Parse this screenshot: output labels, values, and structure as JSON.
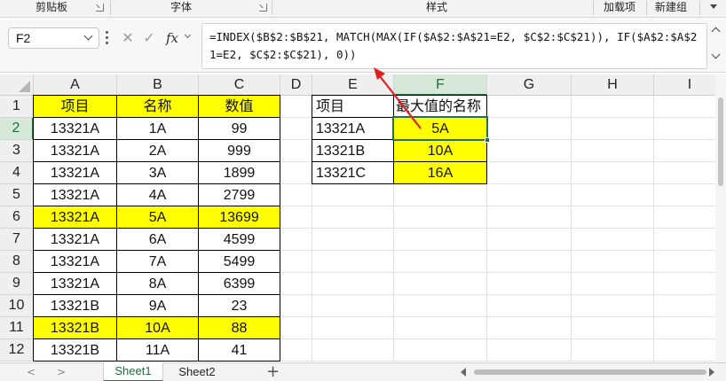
{
  "ribbon": {
    "groups": [
      "剪贴板",
      "字体",
      "样式",
      "加载项",
      "新建组"
    ]
  },
  "formula_bar": {
    "name_box": "F2",
    "icons": [
      "cancel-icon",
      "confirm-icon",
      "fx-icon"
    ],
    "fx_label": "fx",
    "formula": "=INDEX($B$2:$B$21, MATCH(MAX(IF($A$2:$A$21=E2, $C$2:$C$21)), IF($A$2:$A$21=E2, $C$2:$C$21), 0))"
  },
  "columns": [
    "A",
    "B",
    "C",
    "D",
    "E",
    "F",
    "G",
    "H",
    "I"
  ],
  "rows": [
    "1",
    "2",
    "3",
    "4",
    "5",
    "6",
    "7",
    "8",
    "9",
    "10",
    "11",
    "12"
  ],
  "selected_cell": "F2",
  "colors": {
    "highlight": "#ffff00",
    "accent": "#217346",
    "arrow": "#e02020"
  },
  "table1": {
    "headers": [
      "项目",
      "名称",
      "数值"
    ],
    "rows": [
      [
        "13321A",
        "1A",
        "99"
      ],
      [
        "13321A",
        "2A",
        "999"
      ],
      [
        "13321A",
        "3A",
        "1899"
      ],
      [
        "13321A",
        "4A",
        "2799"
      ],
      [
        "13321A",
        "5A",
        "13699"
      ],
      [
        "13321A",
        "6A",
        "4599"
      ],
      [
        "13321A",
        "7A",
        "5499"
      ],
      [
        "13321A",
        "8A",
        "6399"
      ],
      [
        "13321B",
        "9A",
        "23"
      ],
      [
        "13321B",
        "10A",
        "88"
      ],
      [
        "13321B",
        "11A",
        "41"
      ]
    ],
    "highlighted_rows": [
      4,
      9
    ]
  },
  "table2": {
    "headers": [
      "项目",
      "最大值的名称"
    ],
    "rows": [
      [
        "13321A",
        "5A"
      ],
      [
        "13321B",
        "10A"
      ],
      [
        "13321C",
        "16A"
      ]
    ]
  },
  "sheet_tabs": {
    "tabs": [
      "Sheet1",
      "Sheet2"
    ],
    "active": "Sheet1",
    "add_label": "+"
  }
}
